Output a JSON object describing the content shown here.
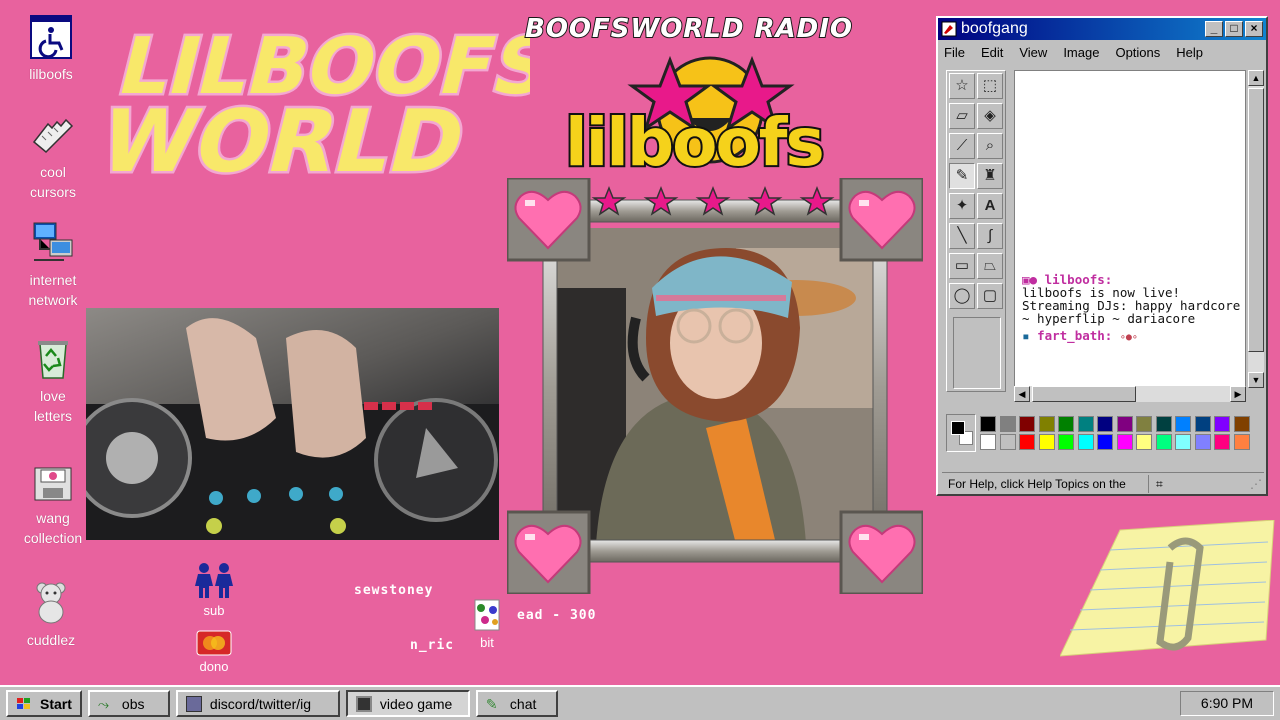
{
  "desktop": {
    "icons": [
      {
        "name": "lilboofs"
      },
      {
        "name": "cool\ncursors"
      },
      {
        "name": "internet\nnetwork"
      },
      {
        "name": "love\nletters"
      },
      {
        "name": "wang\ncollection"
      },
      {
        "name": "cuddlez"
      }
    ],
    "wang_mini_label": "WANG"
  },
  "overlay": {
    "logo_top": "LILBOOFS",
    "logo_bottom": "WORLD",
    "radio_title": "BOOFSWORLD RADIO",
    "brand": "lilboofs",
    "sub_label": "sub",
    "dono_label": "dono",
    "bit_label": "bit",
    "recent_sub": "sewstoney",
    "recent_dono": "n_ric",
    "bit_goal": "ead - 300"
  },
  "paint": {
    "title": "boofgang",
    "menu": [
      "File",
      "Edit",
      "View",
      "Image",
      "Options",
      "Help"
    ],
    "status": "For Help, click Help Topics on the",
    "chat": [
      {
        "user": "lilboofs:",
        "message": "lilboofs is now live! Streaming DJs: happy hardcore ~ hyperflip ~ dariacore"
      },
      {
        "user": "fart_bath:",
        "message": ""
      }
    ],
    "palette_top": [
      "#000000",
      "#808080",
      "#800000",
      "#808000",
      "#008000",
      "#008080",
      "#000080",
      "#800080",
      "#808040",
      "#004040",
      "#0080ff",
      "#004080",
      "#8000ff",
      "#804000"
    ],
    "palette_bottom": [
      "#ffffff",
      "#c0c0c0",
      "#ff0000",
      "#ffff00",
      "#00ff00",
      "#00ffff",
      "#0000ff",
      "#ff00ff",
      "#ffff80",
      "#00ff80",
      "#80ffff",
      "#8080ff",
      "#ff0080",
      "#ff8040"
    ]
  },
  "taskbar": {
    "start": "Start",
    "buttons": [
      "obs",
      "discord/twitter/ig",
      "video game",
      "chat"
    ],
    "active": "video game",
    "clock": "6:90 PM"
  },
  "colors": {
    "desktop": "#e8629e",
    "title_bar": "#000080",
    "brand_yellow": "#f5d21b",
    "heart_pink": "#ff6fb0"
  }
}
